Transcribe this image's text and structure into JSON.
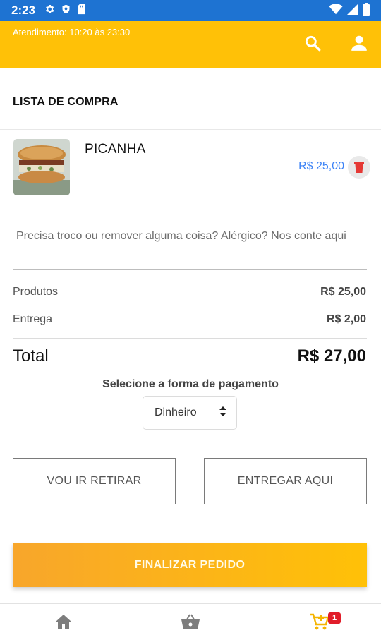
{
  "status_bar": {
    "time": "2:23",
    "left_icons": [
      "gear-icon",
      "shield-icon",
      "sim-card-icon"
    ],
    "right_icons": [
      "wifi-icon",
      "signal-icon",
      "battery-icon"
    ]
  },
  "header": {
    "hours": "Atendimento: 10:20 às 23:30",
    "icons": [
      "search-icon",
      "user-icon"
    ],
    "background": "#ffc107"
  },
  "cart": {
    "title": "LISTA DE COMPRA",
    "items": [
      {
        "name": "PICANHA",
        "price": "R$ 25,00"
      }
    ]
  },
  "notes": {
    "placeholder": "Precisa troco ou remover alguma coisa? Alérgico? Nos conte aqui",
    "value": ""
  },
  "summary": {
    "products_label": "Produtos",
    "products_value": "R$ 25,00",
    "delivery_label": "Entrega",
    "delivery_value": "R$ 2,00",
    "total_label": "Total",
    "total_value": "R$ 27,00"
  },
  "payment": {
    "title": "Selecione a forma de pagamento",
    "selected": "Dinheiro"
  },
  "delivery_options": {
    "pickup_label": "VOU IR RETIRAR",
    "deliver_label": "ENTREGAR AQUI"
  },
  "finalize": {
    "label": "FINALIZAR PEDIDO"
  },
  "bottom_nav": {
    "items": [
      "home-icon",
      "basket-icon",
      "cart-icon"
    ],
    "cart_count": "1"
  },
  "colors": {
    "accent": "#ffc107",
    "status_bar": "#1e73d2",
    "price": "#3b82f6",
    "badge": "#e11d2a",
    "delete_icon": "#e53935"
  }
}
